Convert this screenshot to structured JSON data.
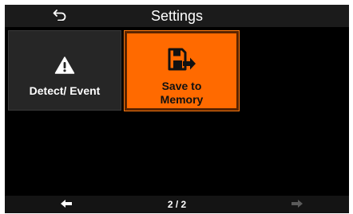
{
  "header": {
    "title": "Settings",
    "back_icon": "back-arrow-icon"
  },
  "tiles": [
    {
      "label": "Detect/ Event",
      "icon": "warning-icon",
      "selected": false,
      "background": "#262626",
      "text_color": "#ffffff"
    },
    {
      "label": "Save to Memory",
      "icon": "save-floppy-icon",
      "selected": true,
      "background": "#ff6a00",
      "text_color": "#111111"
    }
  ],
  "footer": {
    "page_indicator": "2 / 2",
    "prev_icon": "arrow-left-icon",
    "next_icon": "arrow-right-icon",
    "next_disabled": true
  },
  "colors": {
    "screen_background": "#000000",
    "header_background": "#1b1b1b",
    "accent": "#ff6a00",
    "disabled": "#5a5a5a"
  }
}
